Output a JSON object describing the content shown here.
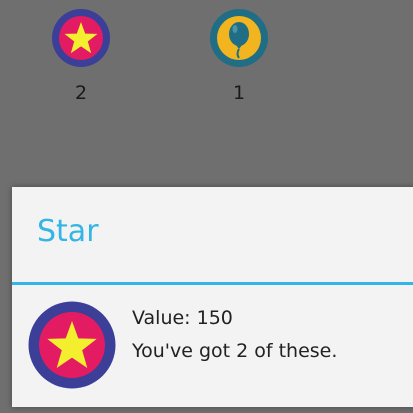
{
  "badges": [
    {
      "name": "Star",
      "icon": "star-badge-icon",
      "count": "2",
      "ring_color": "#3b3f97",
      "fill_color": "#e31b63",
      "symbol_color": "#f3ee2e"
    },
    {
      "name": "Balloon",
      "icon": "balloon-badge-icon",
      "count": "1",
      "ring_color": "#1f6e86",
      "fill_color": "#f2b51f",
      "symbol_color": "#1f6e86"
    }
  ],
  "dialog": {
    "title": "Star",
    "value_text": "Value: 150",
    "message": "You've got 2 of these.",
    "accent_color": "#33b5e5"
  }
}
